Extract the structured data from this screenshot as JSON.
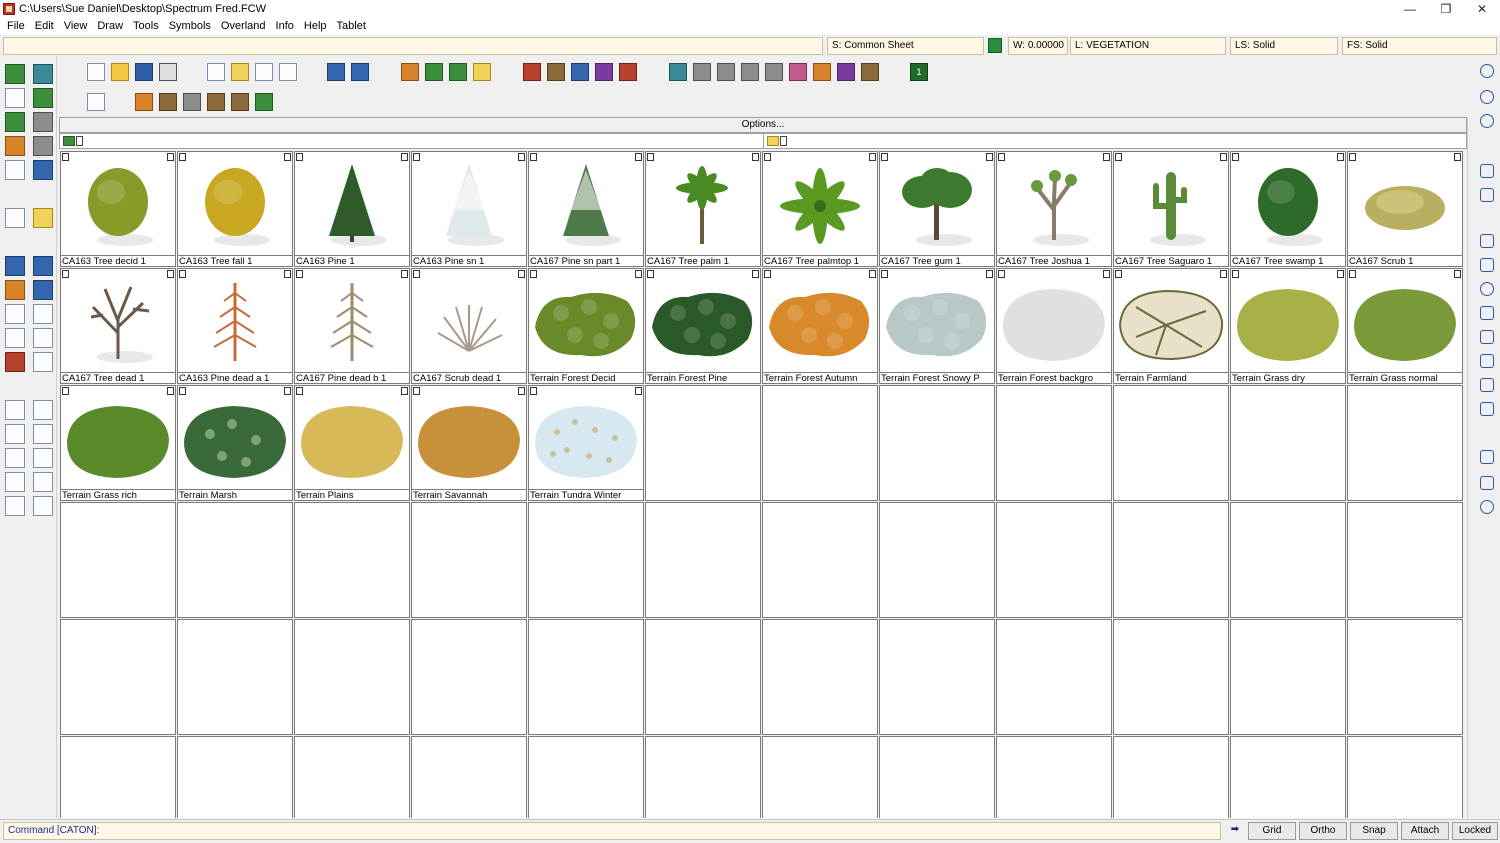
{
  "window": {
    "title": "C:\\Users\\Sue Daniel\\Desktop\\Spectrum Fred.FCW",
    "minimize_glyph": "—",
    "maximize_glyph": "❐",
    "close_glyph": "✕"
  },
  "menu": [
    "File",
    "Edit",
    "View",
    "Draw",
    "Tools",
    "Symbols",
    "Overland",
    "Info",
    "Help",
    "Tablet"
  ],
  "status": {
    "sheet": "S: Common Sheet",
    "width": "W: 0.00000",
    "layer": "L: VEGETATION",
    "line_style": "LS: Solid",
    "fill_style": "FS: Solid",
    "current_color": "#2e8b3e"
  },
  "panel": {
    "options_label": "Options..."
  },
  "symbols": [
    {
      "label": "CA163 Tree decid 1",
      "kind": "tree-round",
      "color": "#8a9a2a"
    },
    {
      "label": "CA163 Tree fall 1",
      "kind": "tree-round",
      "color": "#c8a820"
    },
    {
      "label": "CA163 Pine 1",
      "kind": "pine",
      "color": "#2f5a2a"
    },
    {
      "label": "CA163 Pine sn 1",
      "kind": "pine-snow",
      "color": "#dfe8ea"
    },
    {
      "label": "CA167 Pine sn part 1",
      "kind": "pine-snow",
      "color": "#4e7a4a"
    },
    {
      "label": "CA167 Tree palm 1",
      "kind": "palm",
      "color": "#4a8a22"
    },
    {
      "label": "CA167 Tree palmtop 1",
      "kind": "palmtop",
      "color": "#5a9a22"
    },
    {
      "label": "CA167 Tree gum 1",
      "kind": "tree-gum",
      "color": "#3e7a2e"
    },
    {
      "label": "CA167 Tree Joshua 1",
      "kind": "joshua",
      "color": "#6a9a3a"
    },
    {
      "label": "CA167 Tree Saguaro 1",
      "kind": "saguaro",
      "color": "#5a8a3a"
    },
    {
      "label": "CA167 Tree swamp 1",
      "kind": "tree-round",
      "color": "#2e6a2a"
    },
    {
      "label": "CA167 Scrub 1",
      "kind": "scrub",
      "color": "#b8b060"
    },
    {
      "label": "CA167 Tree dead 1",
      "kind": "dead",
      "color": "#6b5a4a"
    },
    {
      "label": "CA163 Pine dead a 1",
      "kind": "dead-pine",
      "color": "#c86a3a"
    },
    {
      "label": "CA167 Pine dead b 1",
      "kind": "dead-pine",
      "color": "#a08a6a"
    },
    {
      "label": "CA167 Scrub dead 1",
      "kind": "dead-scrub",
      "color": "#a89a8a"
    },
    {
      "label": "Terrain Forest Decid",
      "kind": "forest",
      "color": "#6a8a2a"
    },
    {
      "label": "Terrain Forest Pine",
      "kind": "forest",
      "color": "#2a5a2a"
    },
    {
      "label": "Terrain Forest Autumn",
      "kind": "forest",
      "color": "#d88a2a"
    },
    {
      "label": "Terrain Forest Snowy P",
      "kind": "forest",
      "color": "#b8c8c8"
    },
    {
      "label": "Terrain Forest backgro",
      "kind": "blob",
      "color": "#e0e0e0"
    },
    {
      "label": "Terrain Farmland",
      "kind": "farmland",
      "color": "#e8e0c8"
    },
    {
      "label": "Terrain Grass dry",
      "kind": "blob",
      "color": "#a8b048"
    },
    {
      "label": "Terrain Grass normal",
      "kind": "blob",
      "color": "#7a9a3a"
    },
    {
      "label": "Terrain Grass rich",
      "kind": "blob",
      "color": "#5a8a2a"
    },
    {
      "label": "Terrain Marsh",
      "kind": "marsh",
      "color": "#3a6a3a"
    },
    {
      "label": "Terrain Plains",
      "kind": "blob",
      "color": "#d8b858"
    },
    {
      "label": "Terrain Savannah",
      "kind": "blob",
      "color": "#c8903a"
    },
    {
      "label": "Terrain Tundra Winter",
      "kind": "tundra",
      "color": "#d8e8f0"
    }
  ],
  "command": {
    "prompt": "Command [CATON]:"
  },
  "bottom_buttons": [
    "Grid",
    "Ortho",
    "Snap",
    "Attach",
    "Locked"
  ]
}
